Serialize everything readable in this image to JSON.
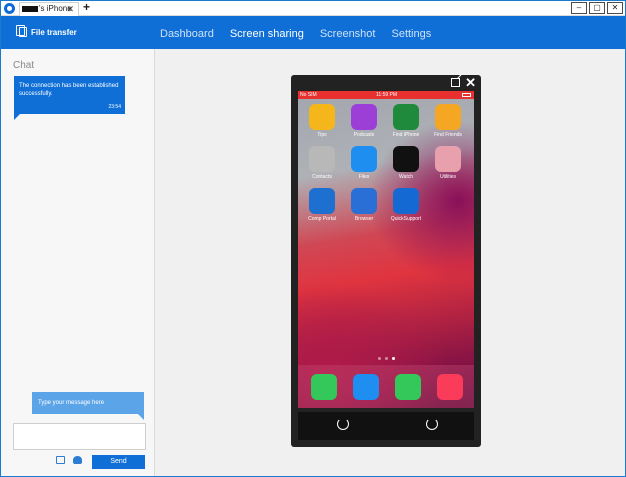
{
  "window": {
    "tab_title": "'s iPhone",
    "tab_close": "✕",
    "add_tab": "+",
    "controls": [
      "‒",
      "▢",
      "✕"
    ]
  },
  "toolbar": {
    "file_transfer": "File transfer",
    "nav": [
      "Dashboard",
      "Screen sharing",
      "Screenshot",
      "Settings"
    ],
    "active_nav": "Screen sharing",
    "accent": "#0f6fd6"
  },
  "chat": {
    "title": "Chat",
    "message": "The connection has been established successfully.",
    "message_time": "23:54",
    "input_placeholder": "Type your message here",
    "send_label": "Send"
  },
  "phone": {
    "status_left": "No SIM",
    "status_time": "11:59 PM",
    "apps": [
      {
        "label": "Tips",
        "icon": "tips-icon",
        "color": "#f4b61a"
      },
      {
        "label": "Podcasts",
        "icon": "podcasts-icon",
        "color": "#9b3fd6"
      },
      {
        "label": "Find iPhone",
        "icon": "find-iphone-icon",
        "color": "#1f8a3c"
      },
      {
        "label": "Find Friends",
        "icon": "find-friends-icon",
        "color": "#f5a623"
      },
      {
        "label": "Contacts",
        "icon": "contacts-icon",
        "color": "#b8b8b8"
      },
      {
        "label": "Files",
        "icon": "files-icon",
        "color": "#1e8ef0"
      },
      {
        "label": "Watch",
        "icon": "watch-icon",
        "color": "#111111"
      },
      {
        "label": "Utilities",
        "icon": "utilities-icon",
        "color": "#e9a0ad"
      },
      {
        "label": "Comp Portal",
        "icon": "comp-portal-icon",
        "color": "#1d6fd0"
      },
      {
        "label": "Browser",
        "icon": "browser-icon",
        "color": "#2a6fd6"
      },
      {
        "label": "QuickSupport",
        "icon": "quicksupport-icon",
        "color": "#1469d2"
      }
    ],
    "dock": [
      {
        "icon": "phone-icon",
        "color": "#34c759"
      },
      {
        "icon": "safari-icon",
        "color": "#1e8ef0"
      },
      {
        "icon": "messages-icon",
        "color": "#34c759"
      },
      {
        "icon": "music-icon",
        "color": "#fa3c5a"
      }
    ]
  }
}
